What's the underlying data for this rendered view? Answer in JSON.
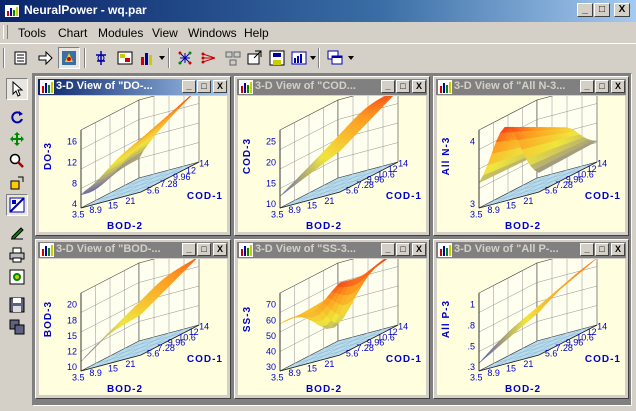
{
  "window": {
    "title": "NeuralPower - wq.par",
    "minimize": "_",
    "maximize": "□",
    "close": "X"
  },
  "menu": [
    "Tools",
    "Chart",
    "Modules",
    "View",
    "Windows",
    "Help"
  ],
  "colors": {
    "titlebar": "#0a246a",
    "plot_bg": "#ffffe0",
    "floor": "#b8dcee",
    "axis_text": "#0000cc"
  },
  "toolbar_icons": [
    "open-icon",
    "forward-arrow-icon",
    "model-icon",
    "train-icon",
    "table-icon",
    "bar-chart-icon",
    "network-icon",
    "weights-icon",
    "network-layout-icon",
    "export-icon",
    "save-chart-icon",
    "chart-dropdown-icon",
    "window-layout-icon"
  ],
  "left_tools": [
    "pointer-icon",
    "rotate-icon",
    "move-icon",
    "zoom-icon",
    "resize-icon",
    "view-toggle-icon",
    "edit-icon",
    "print-icon",
    "settings-icon",
    "save-icon",
    "copy-icon"
  ],
  "charts": [
    {
      "title": "3-D View of \"DO-...",
      "zlabel": "DO-3",
      "xlabel": "BOD-2",
      "ylabel": "COD-1",
      "zticks": [
        "16",
        "12",
        "8",
        "4"
      ],
      "xticks": [
        "3.5",
        "8.9",
        "15",
        "21"
      ],
      "yticks": [
        "14",
        "12",
        "9.96",
        "7.28",
        "5.6"
      ],
      "surface": "do"
    },
    {
      "title": "3-D View of \"COD...",
      "zlabel": "COD-3",
      "xlabel": "BOD-2",
      "ylabel": "COD-1",
      "zticks": [
        "25",
        "20",
        "15",
        "10"
      ],
      "xticks": [
        "3.5",
        "8.9",
        "15",
        "21"
      ],
      "yticks": [
        "14",
        "12",
        "10.6",
        "9.96",
        "7.28",
        "5.6"
      ],
      "surface": "cod"
    },
    {
      "title": "3-D View of \"All N-3...",
      "zlabel": "All N-3",
      "xlabel": "BOD-2",
      "ylabel": "COD-1",
      "zticks": [
        "4",
        "3"
      ],
      "xticks": [
        "3.5",
        "8.9",
        "15",
        "21"
      ],
      "yticks": [
        "14",
        "12",
        "10.6",
        "9.96",
        "7.28",
        "5.6"
      ],
      "surface": "n"
    },
    {
      "title": "3-D View of \"BOD-...",
      "zlabel": "BOD-3",
      "xlabel": "BOD-2",
      "ylabel": "COD-1",
      "zticks": [
        "20",
        "18",
        "15",
        "12",
        "10"
      ],
      "xticks": [
        "3.5",
        "8.9",
        "15",
        "21"
      ],
      "yticks": [
        "14",
        "12",
        "10.6",
        "9.96",
        "7.28",
        "5.6"
      ],
      "surface": "bod"
    },
    {
      "title": "3-D View of \"SS-3...",
      "zlabel": "SS-3",
      "xlabel": "BOD-2",
      "ylabel": "COD-1",
      "zticks": [
        "70",
        "60",
        "50",
        "40",
        "30"
      ],
      "xticks": [
        "3.5",
        "8.9",
        "15",
        "21"
      ],
      "yticks": [
        "14",
        "12",
        "10.6",
        "9.96",
        "7.28",
        "5.6"
      ],
      "surface": "ss"
    },
    {
      "title": "3-D View of \"All P-...",
      "zlabel": "All P-3",
      "xlabel": "BOD-2",
      "ylabel": "COD-1",
      "zticks": [
        "1",
        ".8",
        ".5",
        ".3"
      ],
      "xticks": [
        "3.5",
        "8.9",
        "15",
        "21"
      ],
      "yticks": [
        "14",
        "12",
        "10.6",
        "9.96",
        "7.28",
        "5.6"
      ],
      "surface": "p"
    }
  ]
}
